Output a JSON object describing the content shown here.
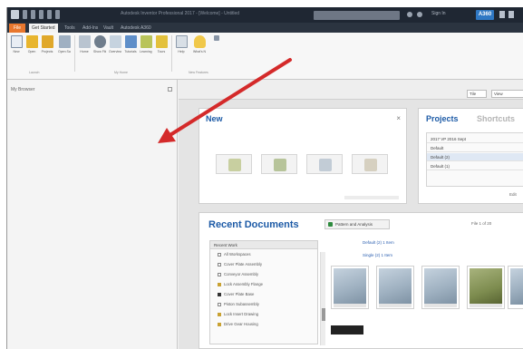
{
  "window": {
    "title": "Autodesk Inventor Professional 2017 - [Welcome] - Untitled",
    "search_placeholder": "Type a keyword or phrase",
    "signin_label": "Sign In",
    "a360_label": "A360"
  },
  "menu_tabs": [
    {
      "label": "File"
    },
    {
      "label": "Get Started"
    },
    {
      "label": "Tools"
    },
    {
      "label": "Add-Ins"
    },
    {
      "label": "Vault"
    },
    {
      "label": "Autodesk A360"
    }
  ],
  "ribbon": {
    "launch": [
      "New",
      "Open",
      "Projects",
      "Open Samples"
    ],
    "my_home": [
      "Home",
      "Show Files",
      "Overview",
      "Tutorials",
      "Learning Path",
      "Tours",
      "Help"
    ],
    "whats_new": [
      "What's New"
    ],
    "panels": [
      "Launch",
      "My Home",
      "New Features"
    ]
  },
  "browser": {
    "heading": "My Browser"
  },
  "home": {
    "view_buttons": [
      "Tile",
      "View"
    ],
    "new_card": {
      "title": "New"
    },
    "projects_card": {
      "tabs": [
        "Projects",
        "Shortcuts"
      ],
      "rows": [
        "2017 VP 2016 Sept",
        "Default",
        "Default (2)",
        "Default (1)"
      ],
      "footer_label": "Edit"
    },
    "recent": {
      "title": "Recent Documents",
      "button_label": "Pattern and Analysis",
      "pager": "File 1 of 20",
      "tree_header": "Recent Work",
      "tree_items": [
        "All Workspaces",
        "Cover Plate Assembly",
        "Conveyor Assembly",
        "Lock Assembly Flange",
        "Cover Plate Base",
        "Piston Subassembly",
        "Lock Insert Drawing",
        "Drive Gear Housing"
      ],
      "group_label_1": "Default (2) 1 Item",
      "group_label_2": "Single (2) 1 Item"
    }
  },
  "colors": {
    "titlebar": "#1f2733",
    "file_tab": "#e8772e",
    "accent_blue": "#1c5aa6",
    "arrow_red": "#d42a2a"
  }
}
